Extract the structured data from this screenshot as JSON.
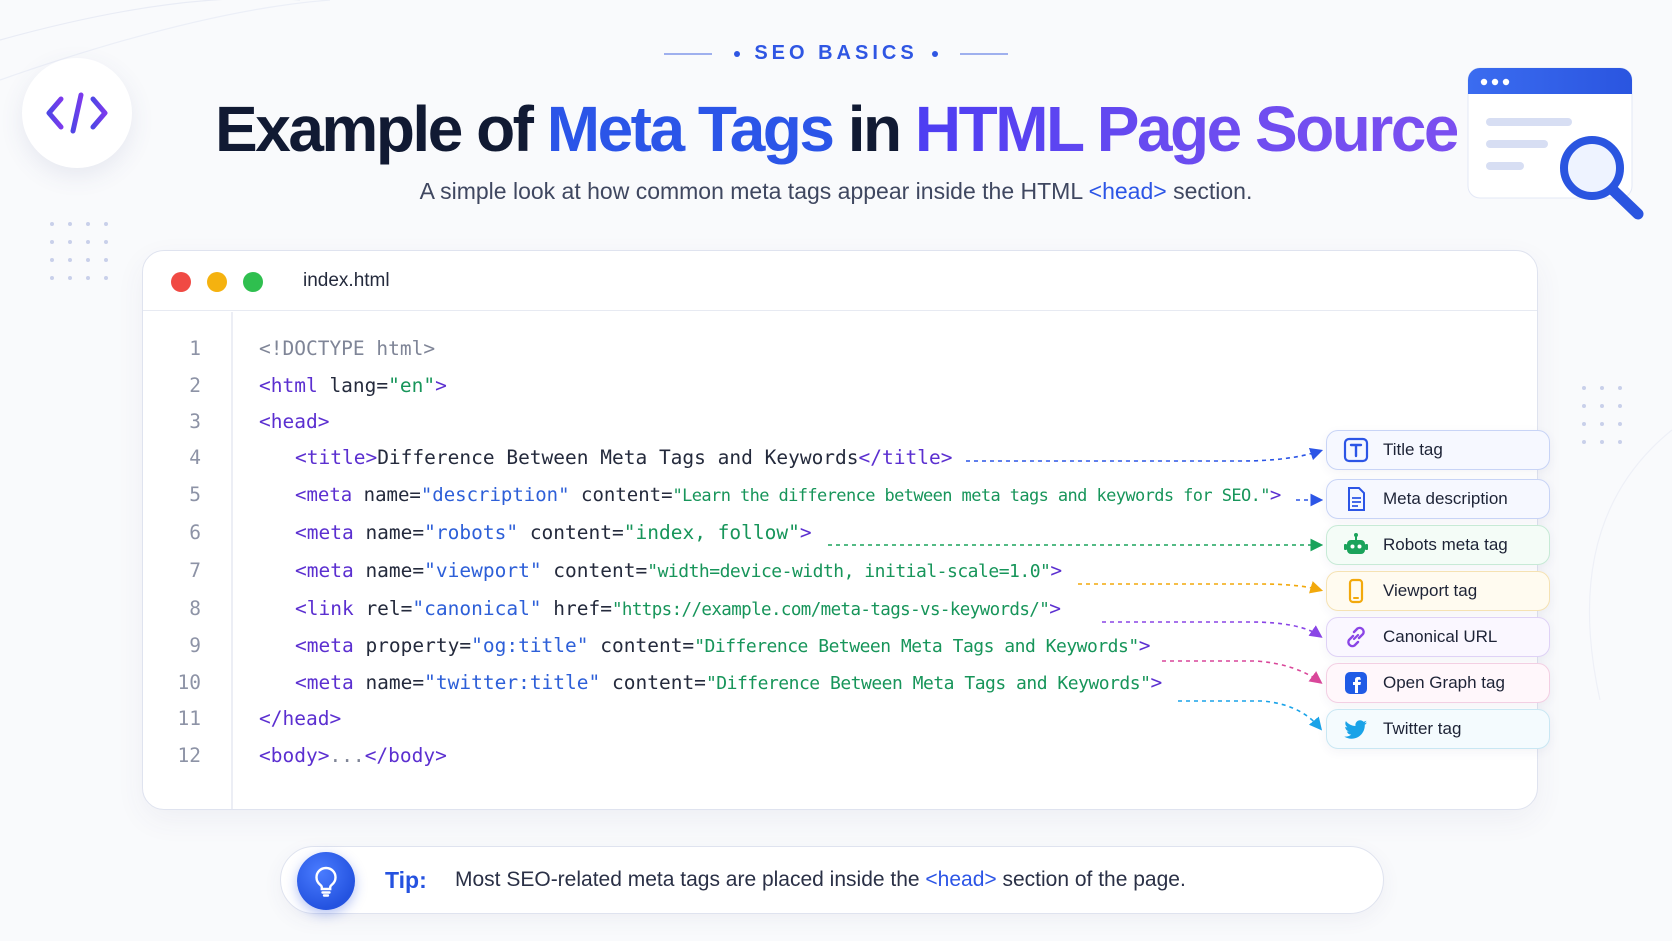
{
  "header": {
    "eyebrow": "SEO BASICS",
    "title_part1": "Example of ",
    "title_part2": "Meta Tags",
    "title_part3": " in ",
    "title_part4": "HTML Page Source",
    "subtitle_before": "A simple look at how common meta tags appear inside the HTML ",
    "subtitle_code": "<head>",
    "subtitle_after": " section."
  },
  "editor": {
    "file_name": "index.html",
    "lines": [
      {
        "n": "1"
      },
      {
        "n": "2"
      },
      {
        "n": "3"
      },
      {
        "n": "4"
      },
      {
        "n": "5"
      },
      {
        "n": "6"
      },
      {
        "n": "7"
      },
      {
        "n": "8"
      },
      {
        "n": "9"
      },
      {
        "n": "10"
      },
      {
        "n": "11"
      },
      {
        "n": "12"
      }
    ],
    "code": {
      "l1": "<!DOCTYPE html>",
      "l2_tag_open": "<html",
      "l2_attr": " lang=",
      "l2_val": "\"en\"",
      "l2_close": ">",
      "l3": "<head>",
      "l4_open": "<title>",
      "l4_text": "Difference Between Meta Tags and Keywords",
      "l4_close": "</title>",
      "l5_tag": "<meta",
      "l5_attr1": " name=",
      "l5_val1": "\"description\"",
      "l5_attr2": " content=",
      "l5_str": "\"Learn the difference between meta tags and keywords for SEO.\"",
      "l5_close": ">",
      "l6_tag": "<meta",
      "l6_attr1": " name=",
      "l6_val1": "\"robots\"",
      "l6_attr2": " content=",
      "l6_val2": "\"index, follow\"",
      "l6_close": ">",
      "l7_tag": "<meta",
      "l7_attr1": " name=",
      "l7_val1": "\"viewport\"",
      "l7_attr2": " content=",
      "l7_str": "\"width=device-width, initial-scale=1.0\"",
      "l7_close": ">",
      "l8_tag": "<link",
      "l8_attr1": " rel=",
      "l8_val1": "\"canonical\"",
      "l8_attr2": " href=",
      "l8_str": "\"https://example.com/meta-tags-vs-keywords/\"",
      "l8_close": ">",
      "l9_tag": "<meta",
      "l9_attr1": " property=",
      "l9_val1": "\"og:title\"",
      "l9_attr2": " content=",
      "l9_str": "\"Difference Between Meta Tags and Keywords\"",
      "l9_close": ">",
      "l10_tag": "<meta",
      "l10_attr1": " name=",
      "l10_val1": "\"twitter:title\"",
      "l10_attr2": " content=",
      "l10_str": "\"Difference Between Meta Tags and Keywords\"",
      "l10_close": ">",
      "l11": "</head>",
      "l12_open": "<body>",
      "l12_dots": "...",
      "l12_close": "</body>"
    }
  },
  "labels": [
    {
      "text": "Title tag",
      "icon": "title-icon",
      "color": "#2c55e6"
    },
    {
      "text": "Meta description",
      "icon": "document-icon",
      "color": "#2c55e6"
    },
    {
      "text": "Robots meta tag",
      "icon": "robot-icon",
      "color": "#1aa35b"
    },
    {
      "text": "Viewport tag",
      "icon": "mobile-icon",
      "color": "#f2a90c"
    },
    {
      "text": "Canonical URL",
      "icon": "link-icon",
      "color": "#8a45e6"
    },
    {
      "text": "Open Graph tag",
      "icon": "facebook-icon",
      "color": "#1f5be6"
    },
    {
      "text": "Twitter tag",
      "icon": "twitter-icon",
      "color": "#1aa3e8"
    }
  ],
  "tip": {
    "label": "Tip:",
    "text_before": "Most SEO-related meta tags are placed inside the ",
    "text_code": "<head>",
    "text_after": " section of the page."
  },
  "colors": {
    "accent_blue": "#2b55e8",
    "accent_purple": "#6b4cf0",
    "tag_purple": "#5b2fd0",
    "string_green": "#17955a"
  }
}
